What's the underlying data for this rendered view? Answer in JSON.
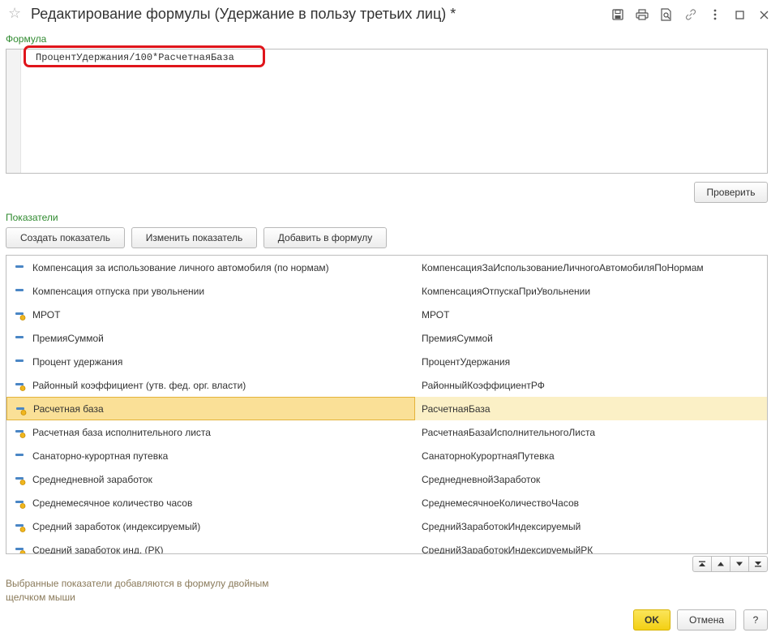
{
  "window": {
    "title": "Редактирование формулы (Удержание в пользу третьих лиц) *",
    "icons": [
      "star-icon",
      "save-icon",
      "print-icon",
      "preview-icon",
      "link-icon",
      "more-icon",
      "maximize-icon",
      "close-icon"
    ]
  },
  "formula": {
    "label": "Формула",
    "text": "ПроцентУдержания/100*РасчетнаяБаза",
    "check_button": "Проверить"
  },
  "indicators": {
    "label": "Показатели",
    "create_button": "Создать показатель",
    "edit_button": "Изменить показатель",
    "add_button": "Добавить в формулу",
    "rows": [
      {
        "name": "Компенсация за использование личного автомобиля (по нормам)",
        "id": "КомпенсацияЗаИспользованиеЛичногоАвтомобиляПоНормам",
        "icon": "indicator-icon",
        "selected": false
      },
      {
        "name": "Компенсация отпуска при увольнении",
        "id": "КомпенсацияОтпускаПриУвольнении",
        "icon": "indicator-icon",
        "selected": false
      },
      {
        "name": "МРОТ",
        "id": "МРОТ",
        "icon": "indicator-period-icon",
        "selected": false
      },
      {
        "name": "ПремияСуммой",
        "id": "ПремияСуммой",
        "icon": "indicator-icon",
        "selected": false
      },
      {
        "name": "Процент удержания",
        "id": "ПроцентУдержания",
        "icon": "indicator-icon",
        "selected": false
      },
      {
        "name": "Районный коэффициент (утв. фед. орг. власти)",
        "id": "РайонныйКоэффициентРФ",
        "icon": "indicator-period-icon",
        "selected": false
      },
      {
        "name": "Расчетная база",
        "id": "РасчетнаяБаза",
        "icon": "indicator-period-icon",
        "selected": true
      },
      {
        "name": "Расчетная база исполнительного листа",
        "id": "РасчетнаяБазаИсполнительногоЛиста",
        "icon": "indicator-period-icon",
        "selected": false
      },
      {
        "name": "Санаторно-курортная путевка",
        "id": "СанаторноКурортнаяПутевка",
        "icon": "indicator-icon",
        "selected": false
      },
      {
        "name": "Среднедневной заработок",
        "id": "СреднедневнойЗаработок",
        "icon": "indicator-period-icon",
        "selected": false
      },
      {
        "name": "Среднемесячное количество часов",
        "id": "СреднемесячноеКоличествоЧасов",
        "icon": "indicator-period-icon",
        "selected": false
      },
      {
        "name": "Средний заработок (индексируемый)",
        "id": "СреднийЗаработокИндексируемый",
        "icon": "indicator-period-icon",
        "selected": false
      },
      {
        "name": "Средний заработок инд. (РК)",
        "id": "СреднийЗаработокИндексируемыйРК",
        "icon": "indicator-period-icon",
        "selected": false
      }
    ]
  },
  "scroll_buttons": [
    "scroll-top-icon",
    "scroll-up-icon",
    "scroll-down-icon",
    "scroll-bottom-icon"
  ],
  "hint": "Выбранные показатели добавляются в формулу двойным щелчком мыши",
  "footer": {
    "ok": "OK",
    "cancel": "Отмена",
    "help": "?"
  },
  "colors": {
    "accent_green": "#2f8a2f",
    "selection": "#fae097",
    "highlight_red": "#e0151b",
    "ok_yellow": "#f3d014"
  }
}
